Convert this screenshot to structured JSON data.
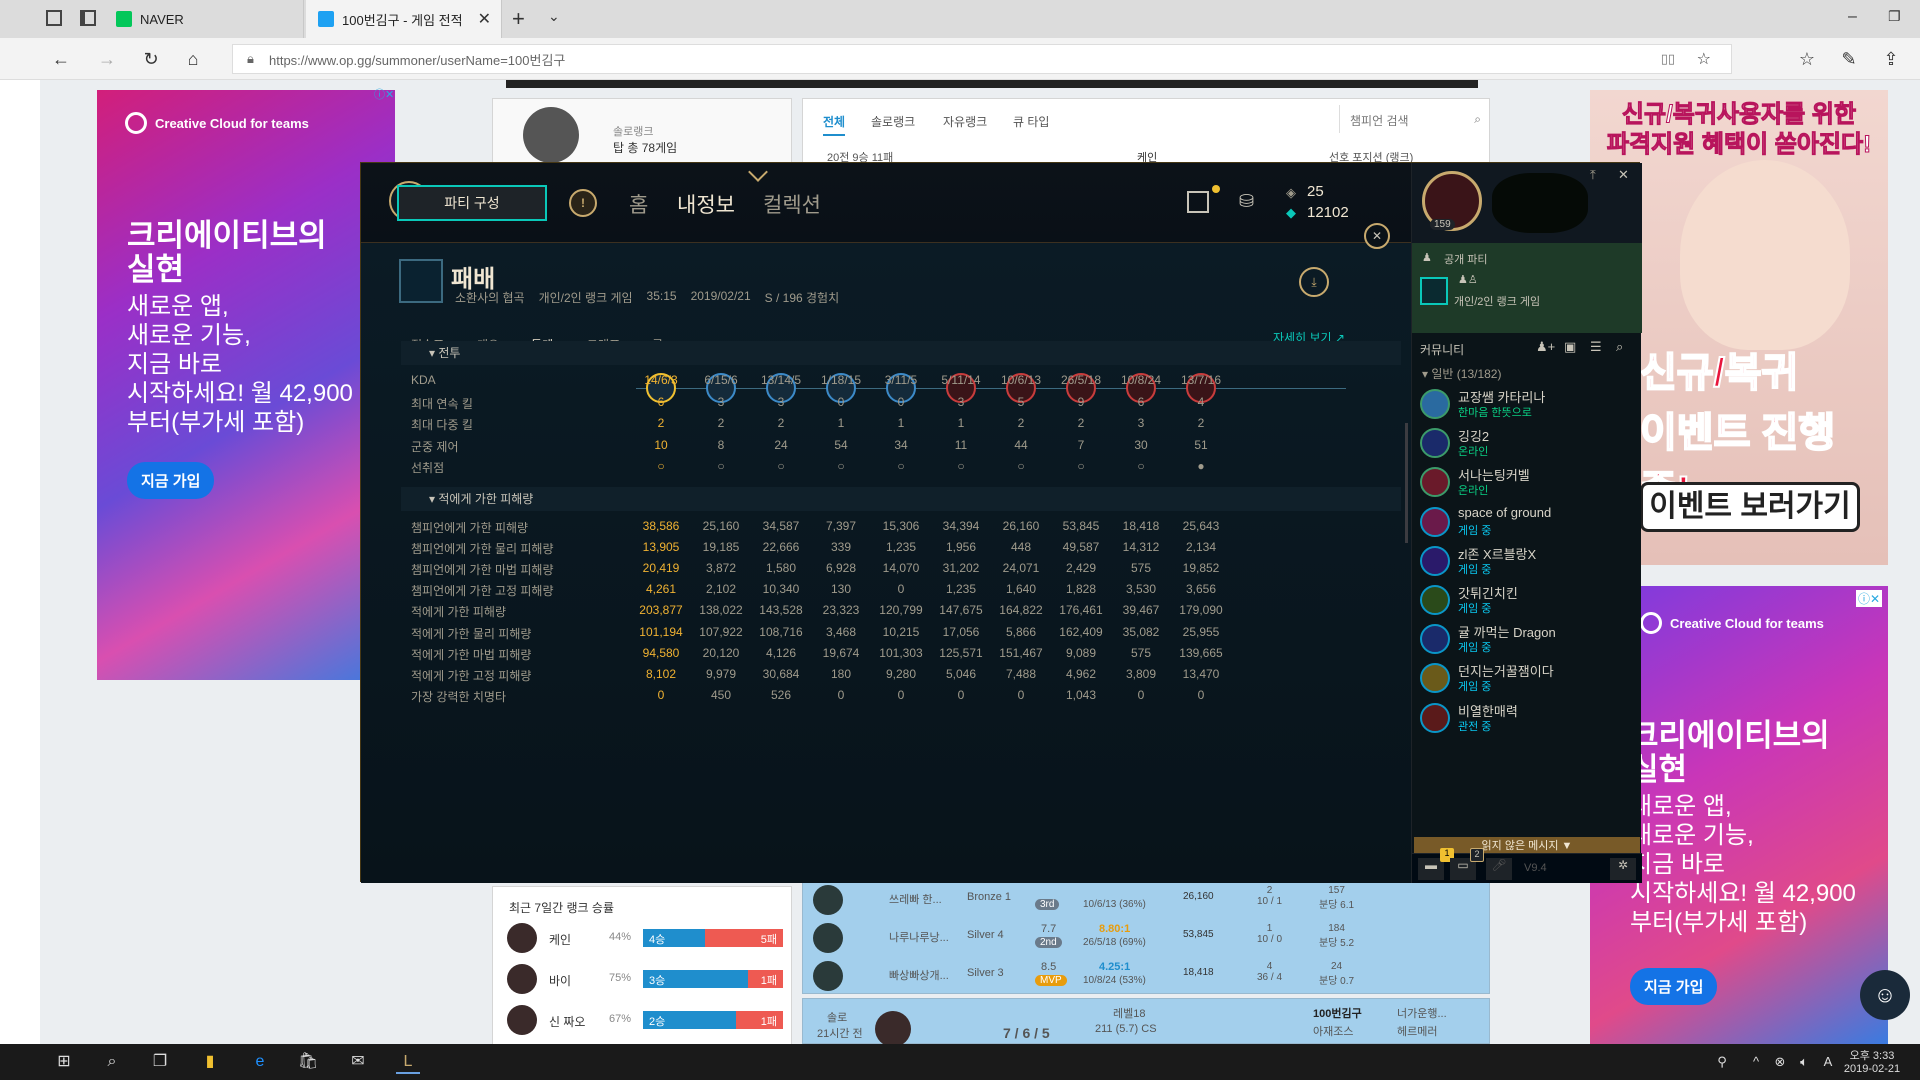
{
  "browser": {
    "tabs": [
      {
        "label": "NAVER"
      },
      {
        "label": "100번김구 - 게임 전적"
      }
    ],
    "url": "https://www.op.gg/summoner/userName=100번김구"
  },
  "ads": {
    "left": {
      "brand": "Creative Cloud for teams",
      "headline1": "크리에이티브의",
      "headline2": "실현",
      "body": "새로운 앱,\n새로운 기능,\n지금 바로\n시작하세요! 월 42,900\n부터(부가세 포함)",
      "cta": "지금 가입"
    },
    "right_top": {
      "text1": "신규/복귀사용자를 위한",
      "text2": "파격지원 혜택이 쏟아진다!",
      "text3": "신규/복귀",
      "text4": "이벤트 진행 중!",
      "cta": "이벤트 보러가기"
    },
    "right_bottom": {
      "brand": "Creative Cloud for teams",
      "headline1": "크리에이티브의",
      "headline2": "실현",
      "body": "새로운 앱,\n새로운 기능,\n지금 바로\n시작하세요! 월 42,900\n부터(부가세 포함)",
      "cta": "지금 가입"
    }
  },
  "opgg": {
    "tabs": [
      "전체",
      "솔로랭크",
      "자유랭크",
      "큐 타입"
    ],
    "champ_search": "챔피언 검색",
    "solo_label": "솔로랭크",
    "solo_games": "탑 총 78게임",
    "recent20": "20전 9승 11패",
    "keyin": "케인",
    "pref_pos": "선호 포지션 (랭크)",
    "week_title": "최근 7일간 랭크 승률",
    "week": [
      {
        "name": "케인",
        "pct": "44%",
        "win": "4승",
        "loss": "5패"
      },
      {
        "name": "바이",
        "pct": "75%",
        "win": "3승",
        "loss": "1패"
      },
      {
        "name": "신 짜오",
        "pct": "67%",
        "win": "2승",
        "loss": "1패"
      }
    ],
    "rows": [
      {
        "name": "쓰레빠 한...",
        "tier": "Bronze 1",
        "rank": "3rd",
        "kda": "10/6/13 (36%)",
        "dmg": "26,160",
        "ward": "2\n10 / 1",
        "cs": "157\n분당 6.1"
      },
      {
        "name": "나루나루낭...",
        "tier": "Silver 4",
        "ratio": "7.7",
        "rank": "2nd",
        "kdaratio": "8.80:1",
        "kda": "26/5/18 (69%)",
        "dmg": "53,845",
        "ward": "1\n10 / 0",
        "cs": "184\n분당 5.2"
      },
      {
        "name": "빠상빠상개...",
        "tier": "Silver 3",
        "ratio": "8.5",
        "rank": "MVP",
        "kdaratio": "4.25:1",
        "kda": "10/8/24 (53%)",
        "dmg": "18,418",
        "ward": "4\n36 / 4",
        "cs": "24\n분당 0.7"
      }
    ],
    "solo_match": {
      "type": "솔로",
      "time": "21시간 전",
      "kda": "7 / 6 / 5",
      "level": "레벨18",
      "cs": "211 (5.7) CS",
      "p1": "100번김구",
      "p2": "아재조스",
      "p3": "너가운행...",
      "p4": "헤르메러"
    }
  },
  "client": {
    "party": "파티 구성",
    "nav": [
      "홈",
      "내정보",
      "컬렉션"
    ],
    "rp": "25",
    "be": "12102",
    "level": "159",
    "result": "패배",
    "map": "소환사의 협곡",
    "queue": "개인/2인 랭크 게임",
    "duration": "35:15",
    "date": "2019/02/21",
    "grade": "S / 196 경험치",
    "subtabs": [
      "점수표",
      "개요",
      "통계",
      "그래프",
      "룬"
    ],
    "more": "자세히 보기 ↗",
    "sections": [
      {
        "title": "전투",
        "rows": [
          {
            "label": "KDA",
            "values": [
              "14/6/3",
              "6/15/6",
              "13/14/5",
              "1/18/15",
              "3/11/5",
              "5/11/14",
              "10/6/13",
              "26/5/18",
              "10/8/24",
              "13/7/16"
            ]
          },
          {
            "label": "최대 연속 킬",
            "values": [
              "6",
              "3",
              "3",
              "0",
              "0",
              "3",
              "5",
              "9",
              "6",
              "4"
            ]
          },
          {
            "label": "최대 다중 킬",
            "values": [
              "2",
              "2",
              "2",
              "1",
              "1",
              "1",
              "2",
              "2",
              "3",
              "2"
            ]
          },
          {
            "label": "군중 제어",
            "values": [
              "10",
              "8",
              "24",
              "54",
              "34",
              "11",
              "44",
              "7",
              "30",
              "51"
            ]
          },
          {
            "label": "선취점",
            "values": [
              "○",
              "○",
              "○",
              "○",
              "○",
              "○",
              "○",
              "○",
              "○",
              "●"
            ]
          }
        ]
      },
      {
        "title": "적에게 가한 피해량",
        "rows": [
          {
            "label": "챔피언에게 가한 피해량",
            "values": [
              "38,586",
              "25,160",
              "34,587",
              "7,397",
              "15,306",
              "34,394",
              "26,160",
              "53,845",
              "18,418",
              "25,643"
            ]
          },
          {
            "label": "챔피언에게 가한 물리 피해량",
            "values": [
              "13,905",
              "19,185",
              "22,666",
              "339",
              "1,235",
              "1,956",
              "448",
              "49,587",
              "14,312",
              "2,134"
            ]
          },
          {
            "label": "챔피언에게 가한 마법 피해량",
            "values": [
              "20,419",
              "3,872",
              "1,580",
              "6,928",
              "14,070",
              "31,202",
              "24,071",
              "2,429",
              "575",
              "19,852"
            ]
          },
          {
            "label": "챔피언에게 가한 고정 피해량",
            "values": [
              "4,261",
              "2,102",
              "10,340",
              "130",
              "0",
              "1,235",
              "1,640",
              "1,828",
              "3,530",
              "3,656"
            ]
          },
          {
            "label": "적에게 가한 피해량",
            "values": [
              "203,877",
              "138,022",
              "143,528",
              "23,323",
              "120,799",
              "147,675",
              "164,822",
              "176,461",
              "39,467",
              "179,090"
            ]
          },
          {
            "label": "적에게 가한 물리 피해량",
            "values": [
              "101,194",
              "107,922",
              "108,716",
              "3,468",
              "10,215",
              "17,056",
              "5,866",
              "162,409",
              "35,082",
              "25,955"
            ]
          },
          {
            "label": "적에게 가한 마법 피해량",
            "values": [
              "94,580",
              "20,120",
              "4,126",
              "19,674",
              "101,303",
              "125,571",
              "151,467",
              "9,089",
              "575",
              "139,665"
            ]
          },
          {
            "label": "적에게 가한 고정 피해량",
            "values": [
              "8,102",
              "9,979",
              "30,684",
              "180",
              "9,280",
              "5,046",
              "7,488",
              "4,962",
              "3,809",
              "13,470"
            ]
          },
          {
            "label": "가장 강력한 치명타",
            "values": [
              "0",
              "450",
              "526",
              "0",
              "0",
              "0",
              "0",
              "1,043",
              "0",
              "0"
            ]
          }
        ]
      }
    ],
    "social": {
      "status": "공개 파티",
      "queue": "개인/2인 랭크 게임",
      "community": "커뮤니티",
      "group": "일반 (13/182)",
      "friends": [
        {
          "name": "교장쌤 카타리나",
          "status": "한마음 한뜻으로"
        },
        {
          "name": "깅깅2",
          "status": "온라인"
        },
        {
          "name": "서나는팅커벨",
          "status": "온라인"
        },
        {
          "name": "space of ground",
          "status": "게임 중"
        },
        {
          "name": "zl존 X르블랑X",
          "status": "게임 중"
        },
        {
          "name": "갓튀긴치킨",
          "status": "게임 중"
        },
        {
          "name": "귤 까먹는 Dragon",
          "status": "게임 중"
        },
        {
          "name": "던지는거꿀잼이다",
          "status": "게임 중"
        },
        {
          "name": "비열한매력",
          "status": "관전 중"
        }
      ],
      "unread": "읽지 않은 메시지 ▼",
      "version": "V9.4",
      "badge1": "1",
      "badge2": "2"
    }
  },
  "taskbar": {
    "time": "오후 3:33",
    "date": "2019-02-21"
  }
}
